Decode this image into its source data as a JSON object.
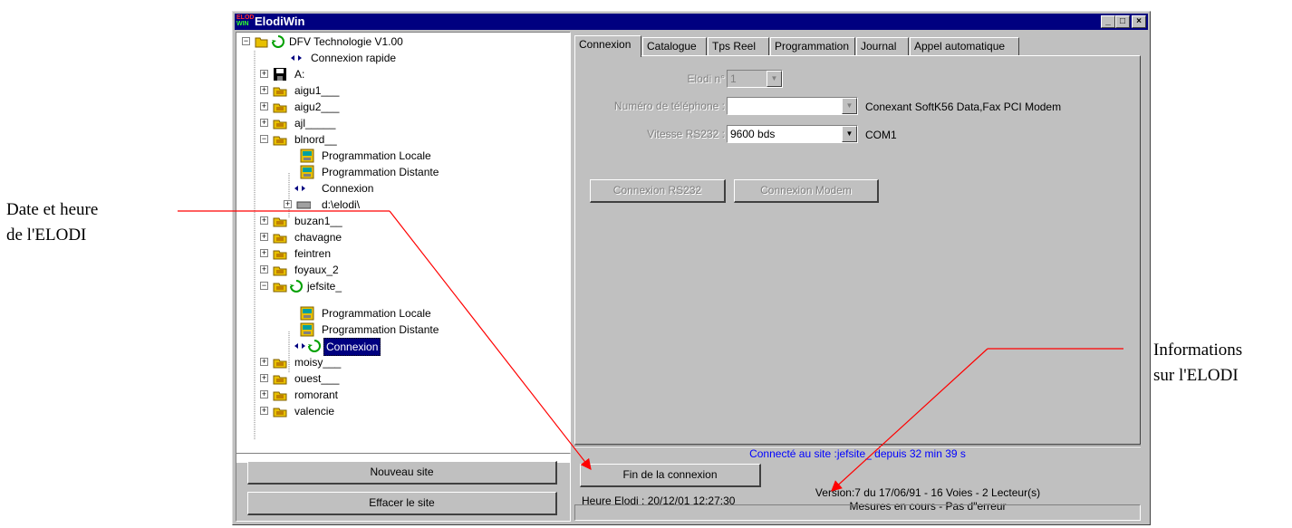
{
  "annotations": {
    "left_line1": "Date et heure",
    "left_line2": "de l'ELODI",
    "right_line1": "Informations",
    "right_line2": "sur l'ELODI"
  },
  "window": {
    "title": "ElodiWin",
    "logo_top": "ELOD",
    "logo_bottom": "WIN",
    "min": "_",
    "max": "□",
    "close": "×"
  },
  "tree": {
    "root": "DFV Technologie V1.00",
    "items": [
      "Connexion rapide",
      "A:",
      "aigu1___",
      "aigu2___",
      "ajl_____",
      "blnord__",
      "Programmation Locale",
      "Programmation Distante",
      "Connexion",
      "d:\\elodi\\",
      "buzan1__",
      "chavagne",
      "feintren",
      "foyaux_2",
      "jefsite_",
      "Programmation Locale",
      "Programmation Distante",
      "Connexion",
      "moisy___",
      "ouest___",
      "romorant",
      "valencie"
    ]
  },
  "left_buttons": {
    "new_site": "Nouveau site",
    "delete_site": "Effacer le site"
  },
  "tabs": [
    "Connexion",
    "Catalogue",
    "Tps Reel",
    "Programmation",
    "Journal",
    "Appel automatique"
  ],
  "form": {
    "elodi_label": "Elodi n°",
    "elodi_value": "1",
    "phone_label": "Numéro de téléphone :",
    "phone_value": "",
    "modem_name": "Conexant SoftK56 Data,Fax PCI Modem",
    "speed_label": "Vitesse RS232 :",
    "speed_value": "9600 bds",
    "port": "COM1",
    "btn_rs232": "Connexion RS232",
    "btn_modem": "Connexion Modem"
  },
  "status": {
    "connected": "Connecté au site :jefsite_ depuis 32 min 39 s",
    "end_connection": "Fin de la connexion",
    "heure": "Heure Elodi : 20/12/01 12:27:30",
    "version": "Version:7 du 17/06/91 - 16 Voies - 2 Lecteur(s)",
    "mesures": "Mesures en cours - Pas d\"erreur"
  },
  "colors": {
    "title_bar": "#000080",
    "status_link": "#0000ff",
    "arrow": "#ff0000",
    "folder": "#e8c000"
  }
}
